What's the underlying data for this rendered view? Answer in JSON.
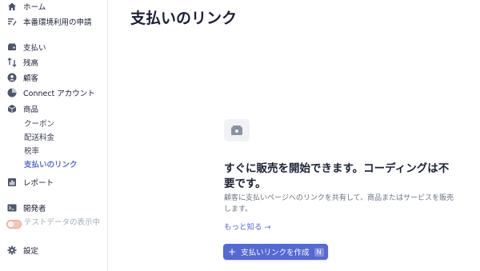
{
  "sidebar": {
    "items": [
      {
        "label": "ホーム",
        "icon": "home-icon"
      },
      {
        "label": "本番環境利用の申請",
        "icon": "edit-list-icon"
      },
      {
        "label": "支払い",
        "icon": "wallet-icon"
      },
      {
        "label": "残高",
        "icon": "transfer-icon"
      },
      {
        "label": "顧客",
        "icon": "user-icon"
      },
      {
        "label": "Connect アカウント",
        "icon": "connect-icon"
      },
      {
        "label": "商品",
        "icon": "box-icon"
      },
      {
        "label": "レポート",
        "icon": "report-icon"
      },
      {
        "label": "開発者",
        "icon": "terminal-icon"
      },
      {
        "label": "設定",
        "icon": "gear-icon"
      }
    ],
    "sub_items": [
      "クーポン",
      "配送料金",
      "税率",
      "支払いのリンク"
    ],
    "test_data_toggle": "テストデータの表示中"
  },
  "main": {
    "title": "支払いのリンク",
    "empty_state": {
      "icon": "payment-link-icon",
      "headline": "すぐに販売を開始できます。コーディングは不要です。",
      "description": "顧客に支払いページへのリンクを共有して、商品またはサービスを販売します。",
      "learn_more": "もっと知る →",
      "create_button": "支払いリンクを作成",
      "create_shortcut": "N"
    }
  },
  "colors": {
    "accent": "#5469d4",
    "text": "#1a1f36",
    "muted": "#697386"
  }
}
